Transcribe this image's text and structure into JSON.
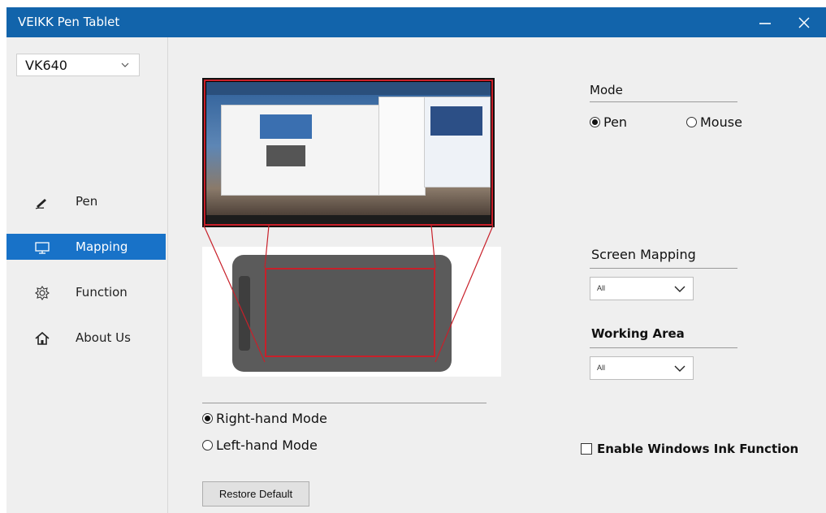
{
  "window": {
    "title": "VEIKK Pen Tablet"
  },
  "sidebar": {
    "device": "VK640",
    "items": [
      {
        "label": "Pen",
        "icon": "pen-icon"
      },
      {
        "label": "Mapping",
        "icon": "monitor-icon"
      },
      {
        "label": "Function",
        "icon": "function-icon"
      },
      {
        "label": "About Us",
        "icon": "home-icon"
      }
    ]
  },
  "mode": {
    "title": "Mode",
    "pen": "Pen",
    "mouse": "Mouse",
    "selected": "Pen"
  },
  "screen_mapping": {
    "title": "Screen Mapping",
    "value": "All"
  },
  "working_area": {
    "title": "Working Area",
    "value": "All"
  },
  "hand_mode": {
    "right": "Right-hand Mode",
    "left": "Left-hand Mode",
    "selected": "Right-hand Mode"
  },
  "ink": {
    "label": "Enable Windows Ink Function",
    "checked": false
  },
  "restore_label": "Restore Default",
  "colors": {
    "titlebar": "#1264ab",
    "active_nav": "#1872c8",
    "mapping_frame": "#c8202a"
  }
}
